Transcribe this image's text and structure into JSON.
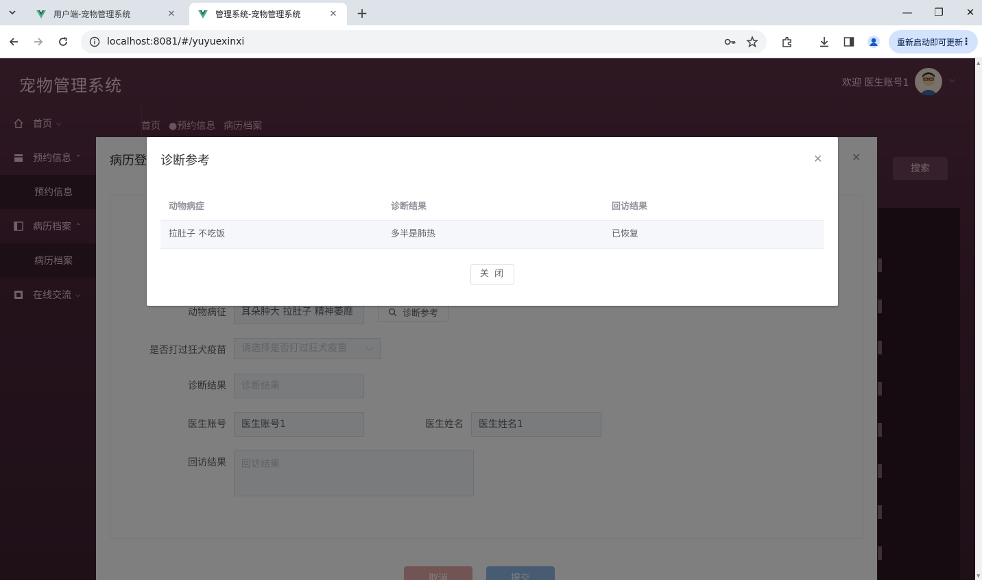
{
  "browser": {
    "tabs": [
      {
        "title": "用户端-宠物管理系统",
        "active": false
      },
      {
        "title": "管理系统-宠物管理系统",
        "active": true
      }
    ],
    "url": "localhost:8081/#/yuyuexinxi",
    "update_label": "重新启动即可更新"
  },
  "app": {
    "title": "宠物管理系统",
    "welcome": "欢迎 医生账号1",
    "sidebar": {
      "items": [
        {
          "label": "首页",
          "icon": "home-icon"
        },
        {
          "label": "预约信息",
          "icon": "calendar-icon"
        },
        {
          "label": "病历档案",
          "icon": "folder-icon"
        },
        {
          "label": "在线交流",
          "icon": "chat-icon"
        }
      ],
      "subitems": [
        "预约信息",
        "病历档案"
      ]
    },
    "breadcrumbs": [
      "首页",
      "●预约信息",
      "病历档案"
    ],
    "search_label": "搜索"
  },
  "record_dialog": {
    "title": "病历登",
    "fields": {
      "symptom_label": "动物病征",
      "symptom_value": "耳朵肿大 拉肚子  精神萎靡",
      "ref_button": "诊断参考",
      "vaccine_label": "是否打过狂犬疫苗",
      "vaccine_placeholder": "请选择是否打过狂犬疫苗",
      "diagnosis_label": "诊断结果",
      "diagnosis_placeholder": "诊断结果",
      "doctor_account_label": "医生账号",
      "doctor_account_value": "医生账号1",
      "doctor_name_label": "医生姓名",
      "doctor_name_value": "医生姓名1",
      "followup_label": "回访结果",
      "followup_placeholder": "回访结果"
    },
    "cancel_label": "取消",
    "submit_label": "提交"
  },
  "reference_dialog": {
    "title": "诊断参考",
    "columns": [
      "动物病症",
      "诊断结果",
      "回访结果"
    ],
    "rows": [
      [
        "拉肚子 不吃饭",
        "多半是肺热",
        "已恢复"
      ]
    ],
    "close_label": "关 闭"
  }
}
